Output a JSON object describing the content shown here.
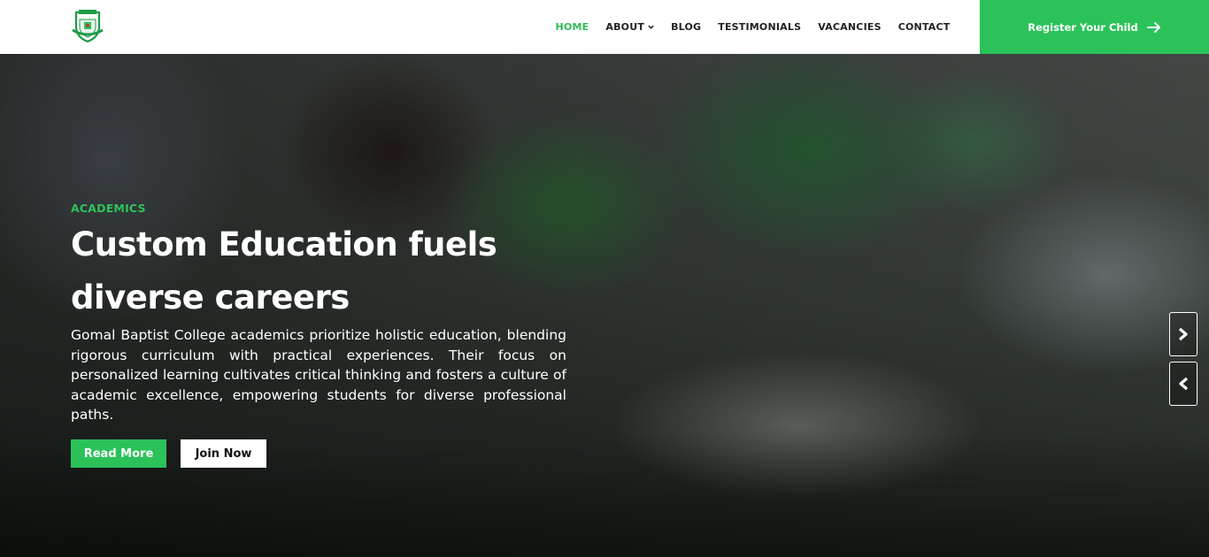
{
  "header": {
    "logo_alt": "Gomal Baptist College logo",
    "nav": [
      {
        "label": "HOME",
        "active": true,
        "has_dropdown": false
      },
      {
        "label": "ABOUT",
        "active": false,
        "has_dropdown": true
      },
      {
        "label": "BLOG",
        "active": false,
        "has_dropdown": false
      },
      {
        "label": "TESTIMONIALS",
        "active": false,
        "has_dropdown": false
      },
      {
        "label": "VACANCIES",
        "active": false,
        "has_dropdown": false
      },
      {
        "label": "CONTACT",
        "active": false,
        "has_dropdown": false
      }
    ],
    "cta_label": "Register Your Child",
    "cta_icon": "arrow-right-icon"
  },
  "hero": {
    "kicker": "ACADEMICS",
    "headline": "Custom Education fuels diverse careers",
    "description": "Gomal Baptist College academics prioritize holistic education, blending rigorous curriculum with practical experiences. Their focus on personalized learning cultivates critical thinking and fosters a culture of academic excellence, empowering students for diverse professional paths.",
    "read_more_label": "Read More",
    "join_now_label": "Join Now",
    "next_icon": "chevron-right-icon",
    "prev_icon": "chevron-left-icon"
  },
  "colors": {
    "accent": "#2bc25a",
    "nav_text": "#222222",
    "white": "#ffffff"
  }
}
